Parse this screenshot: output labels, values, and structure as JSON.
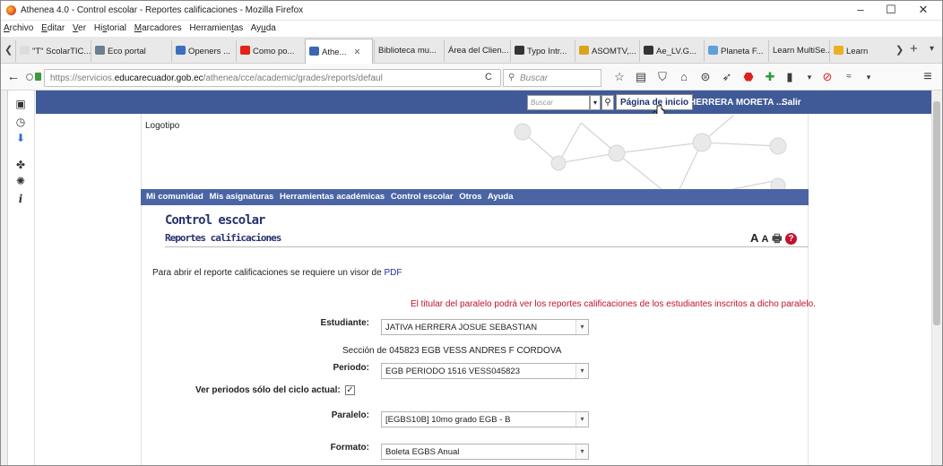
{
  "window": {
    "title": "Athenea 4.0 - Control escolar - Reportes calificaciones - Mozilla Firefox",
    "minimize": "–",
    "maximize": "☐",
    "close": "✕"
  },
  "menubar": {
    "items": [
      {
        "pre": "",
        "u": "A",
        "post": "rchivo"
      },
      {
        "pre": "",
        "u": "E",
        "post": "ditar"
      },
      {
        "pre": "",
        "u": "V",
        "post": "er"
      },
      {
        "pre": "Hi",
        "u": "s",
        "post": "torial"
      },
      {
        "pre": "",
        "u": "M",
        "post": "arcadores"
      },
      {
        "pre": "Herramien",
        "u": "t",
        "post": "as"
      },
      {
        "pre": "Ay",
        "u": "u",
        "post": "da"
      }
    ]
  },
  "tabs": [
    {
      "label": "\"T\" ScolarTIC...",
      "color": "#ffffff"
    },
    {
      "label": "Eco portal",
      "color": "#6a7f8f"
    },
    {
      "label": "Openers ...",
      "color": "#3a6fbf"
    },
    {
      "label": "Como po...",
      "color": "#e62117"
    },
    {
      "label": "Athe...",
      "color": "#3a66b5",
      "active": true,
      "close": "✕"
    },
    {
      "label": "Biblioteca mu...",
      "color": "#ffffff"
    },
    {
      "label": "Área del Clien...",
      "color": "#ffffff"
    },
    {
      "label": "Typo Intr...",
      "color": "#333333"
    },
    {
      "label": "ASOMTV,...",
      "color": "#d9a31a"
    },
    {
      "label": "Ae_LV.G...",
      "color": "#333333"
    },
    {
      "label": "Planeta F...",
      "color": "#5fa0d9"
    },
    {
      "label": "Learn MultiSe...",
      "color": "#ffffff"
    },
    {
      "label": "Learn",
      "color": "#e9b11f"
    }
  ],
  "tabbar_controls": {
    "scroll": "❯",
    "new_tab": "+",
    "list": "▾",
    "back_small": "❮"
  },
  "navbar": {
    "url_prefix": "https://servicios.",
    "url_domain": "educarecuador.gob.ec",
    "url_path": "/athenea/cce/academic/grades/reports/defaul",
    "reload": "C",
    "search_placeholder": "Buscar",
    "back": "←",
    "menu": "≡"
  },
  "site": {
    "search_placeholder": "Buscar",
    "home_label": "Página de inicio",
    "user_label": "HERRERA MORETA ...",
    "logout_label": "Salir",
    "logo_text": "Logotipo",
    "nav": [
      "Mi comunidad",
      "Mis asignaturas",
      "Herramientas académicas",
      "Control escolar",
      "Otros",
      "Ayuda"
    ],
    "page_title": "Control escolar",
    "page_subtitle": "Reportes calificaciones",
    "font_large": "A",
    "font_small": "A",
    "print": "🖶",
    "help": "?",
    "pdf_note_text": "Para abrir el reporte calificaciones se requiere un visor de",
    "pdf_note_link": "PDF",
    "warning": "El titular del paralelo podrá ver los reportes calificaciones de los estudiantes inscritos a dicho paralelo."
  },
  "form": {
    "estudiante_label": "Estudiante:",
    "estudiante_value": "JATIVA HERRERA JOSUE SEBASTIAN",
    "seccion_text": "Sección de 045823 EGB VESS ANDRES F CORDOVA",
    "periodo_label": "Periodo:",
    "periodo_value": "EGB PERIODO 1516 VESS045823",
    "ciclo_label": "Ver periodos sólo del ciclo actual:",
    "ciclo_checked": "✓",
    "paralelo_label": "Paralelo:",
    "paralelo_value": "[EGBS10B] 10mo grado EGB - B",
    "formato_label": "Formato:",
    "formato_value": "Boleta EGBS Anual",
    "dropdown_arrow": "▾"
  },
  "colors": {
    "site_blue": "#3f5a96",
    "nav_blue": "#4a64a4",
    "title_blue": "#26336e",
    "warning_red": "#c4102b"
  }
}
